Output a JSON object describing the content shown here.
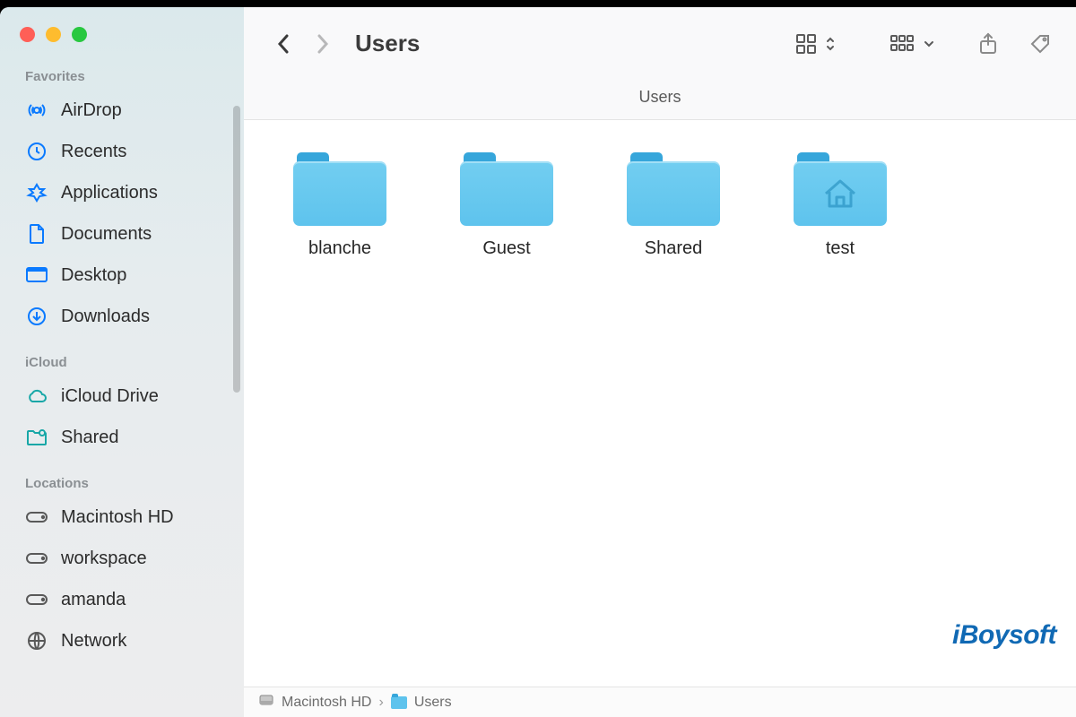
{
  "window": {
    "title": "Users",
    "subheader": "Users"
  },
  "sidebar": {
    "sections": [
      {
        "title": "Favorites",
        "items": [
          {
            "icon": "airdrop-icon",
            "label": "AirDrop"
          },
          {
            "icon": "recents-icon",
            "label": "Recents"
          },
          {
            "icon": "applications-icon",
            "label": "Applications"
          },
          {
            "icon": "documents-icon",
            "label": "Documents"
          },
          {
            "icon": "desktop-icon",
            "label": "Desktop"
          },
          {
            "icon": "downloads-icon",
            "label": "Downloads"
          }
        ]
      },
      {
        "title": "iCloud",
        "items": [
          {
            "icon": "icloud-drive-icon",
            "label": "iCloud Drive"
          },
          {
            "icon": "shared-folder-icon",
            "label": "Shared"
          }
        ]
      },
      {
        "title": "Locations",
        "items": [
          {
            "icon": "disk-icon",
            "label": "Macintosh HD"
          },
          {
            "icon": "disk-icon",
            "label": "workspace"
          },
          {
            "icon": "disk-icon",
            "label": "amanda"
          },
          {
            "icon": "network-icon",
            "label": "Network"
          }
        ]
      }
    ]
  },
  "folders": [
    {
      "name": "blanche",
      "home": false
    },
    {
      "name": "Guest",
      "home": false
    },
    {
      "name": "Shared",
      "home": false
    },
    {
      "name": "test",
      "home": true
    }
  ],
  "pathbar": {
    "segments": [
      {
        "icon": "disk-mini-icon",
        "label": "Macintosh HD"
      },
      {
        "icon": "folder-mini-icon",
        "label": "Users"
      }
    ]
  },
  "watermark": "iBoysoft"
}
